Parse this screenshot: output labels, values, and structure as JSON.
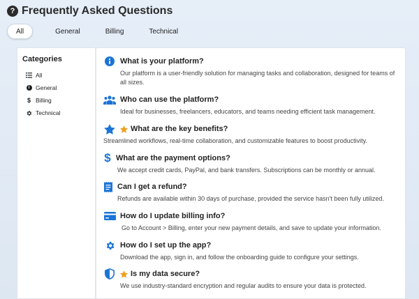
{
  "header": {
    "title": "Frequently Asked Questions"
  },
  "tabs": [
    {
      "label": "All",
      "active": true
    },
    {
      "label": "General",
      "active": false
    },
    {
      "label": "Billing",
      "active": false
    },
    {
      "label": "Technical",
      "active": false
    }
  ],
  "sidebar": {
    "title": "Categories",
    "items": [
      {
        "label": "All",
        "icon": "list-icon"
      },
      {
        "label": "General",
        "icon": "info-icon"
      },
      {
        "label": "Billing",
        "icon": "dollar-icon"
      },
      {
        "label": "Technical",
        "icon": "gear-icon"
      }
    ]
  },
  "faqs": [
    {
      "question": "What is your platform?",
      "answer": "Our platform is a user-friendly solution for managing tasks and collaboration, designed for teams of all sizes.",
      "icon": "info-icon",
      "starred": false
    },
    {
      "question": "Who can use the platform?",
      "answer": "Ideal for businesses, freelancers, educators, and teams needing efficient task management.",
      "icon": "users-icon",
      "starred": false
    },
    {
      "question": "What are the key benefits?",
      "answer": "Streamlined workflows, real-time collaboration, and customizable features to boost productivity.",
      "icon": "star-icon",
      "starred": true
    },
    {
      "question": "What are the payment options?",
      "answer": "We accept credit cards, PayPal, and bank transfers. Subscriptions can be monthly or annual.",
      "icon": "dollar-icon",
      "starred": false
    },
    {
      "question": "Can I get a refund?",
      "answer": "Refunds are available within 30 days of purchase, provided the service hasn't been fully utilized.",
      "icon": "receipt-icon",
      "starred": false
    },
    {
      "question": "How do I update billing info?",
      "answer": "Go to Account > Billing, enter your new payment details, and save to update your information.",
      "icon": "credit-card-icon",
      "starred": false
    },
    {
      "question": "How do I set up the app?",
      "answer": "Download the app, sign in, and follow the onboarding guide to configure your settings.",
      "icon": "gear-icon",
      "starred": false
    },
    {
      "question": "Is my data secure?",
      "answer": "We use industry-standard encryption and regular audits to ensure your data is protected.",
      "icon": "shield-icon",
      "starred": true
    }
  ],
  "colors": {
    "accent": "#1b74d6",
    "star": "#f0a020"
  }
}
